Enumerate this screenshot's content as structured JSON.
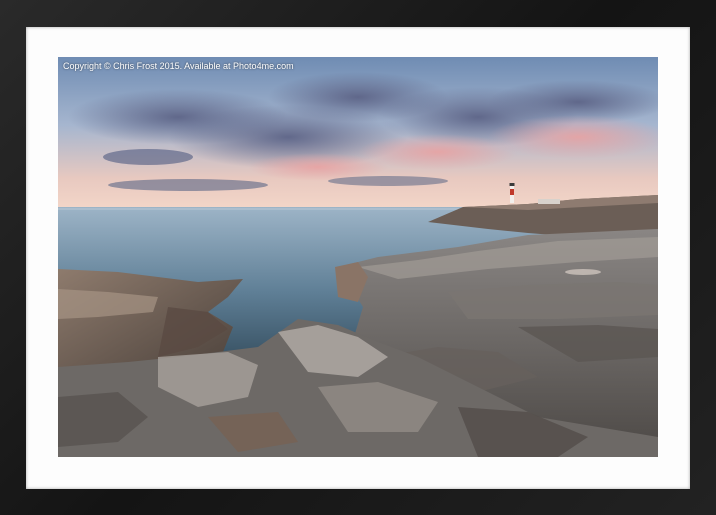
{
  "photo": {
    "watermark": "Copyright © Chris Frost 2015. Available at Photo4me.com"
  }
}
